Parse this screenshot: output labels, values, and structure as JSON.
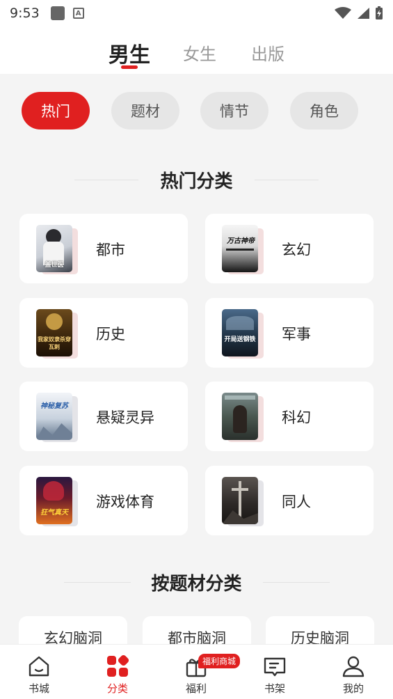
{
  "status_bar": {
    "time": "9:53"
  },
  "top_tabs": [
    {
      "label": "男生",
      "active": true
    },
    {
      "label": "女生",
      "active": false
    },
    {
      "label": "出版",
      "active": false
    }
  ],
  "filter_pills": [
    {
      "label": "热门",
      "active": true
    },
    {
      "label": "题材",
      "active": false
    },
    {
      "label": "情节",
      "active": false
    },
    {
      "label": "角色",
      "active": false
    }
  ],
  "hot_section": {
    "title": "热门分类",
    "items": [
      {
        "label": "都市",
        "cover_text": "盖世医"
      },
      {
        "label": "玄幻",
        "cover_text": "万古神帝"
      },
      {
        "label": "历史",
        "cover_text": "我家奴隶杀穿瓦剌"
      },
      {
        "label": "军事",
        "cover_text": "开局送钢铁"
      },
      {
        "label": "悬疑灵异",
        "cover_text": "神秘复苏"
      },
      {
        "label": "科幻",
        "cover_text": ""
      },
      {
        "label": "游戏体育",
        "cover_text": "狂气真天"
      },
      {
        "label": "同人",
        "cover_text": ""
      }
    ]
  },
  "theme_section": {
    "title": "按题材分类",
    "items": [
      "玄幻脑洞",
      "都市脑洞",
      "历史脑洞"
    ]
  },
  "bottom_nav": {
    "items": [
      {
        "label": "书城",
        "icon": "home-icon",
        "active": false
      },
      {
        "label": "分类",
        "icon": "category-icon",
        "active": true
      },
      {
        "label": "福利",
        "icon": "gift-icon",
        "active": false
      },
      {
        "label": "书架",
        "icon": "bookshelf-icon",
        "active": false
      },
      {
        "label": "我的",
        "icon": "profile-icon",
        "active": false
      }
    ],
    "badge": "福利商城"
  },
  "colors": {
    "accent": "#e02020",
    "background": "#f4f4f4"
  }
}
